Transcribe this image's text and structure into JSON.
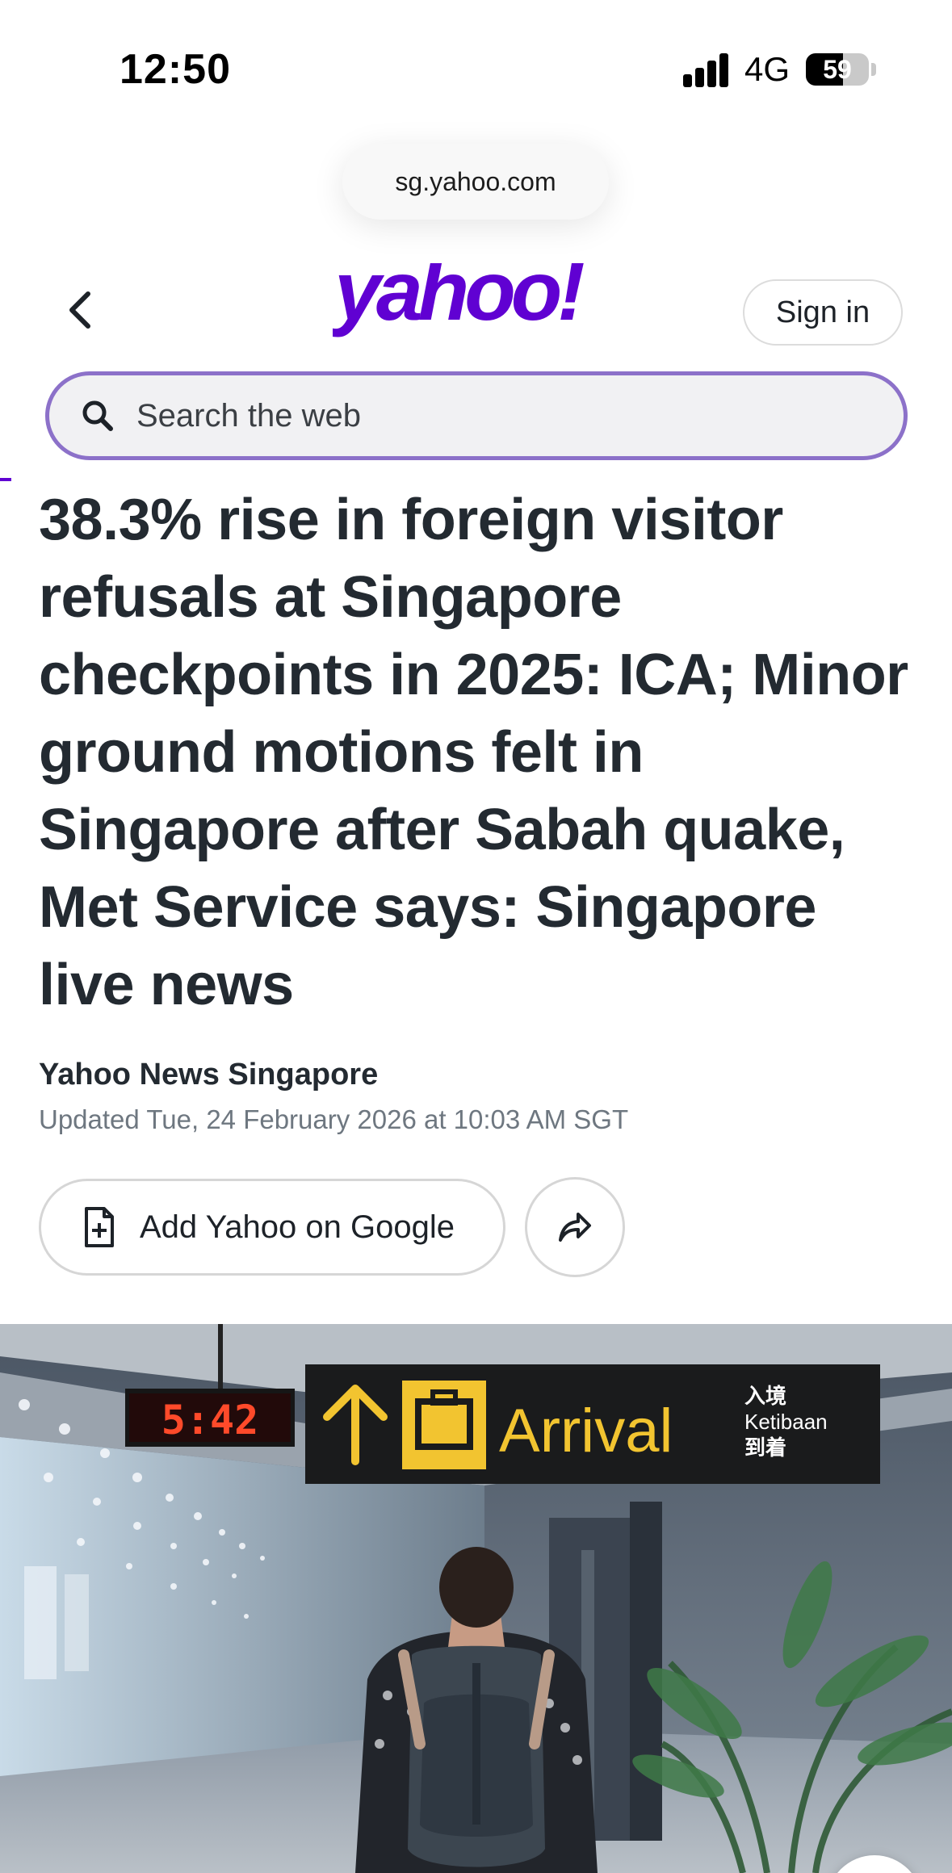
{
  "status_bar": {
    "time": "12:50",
    "network": "4G",
    "battery_percent": "59",
    "battery_level": 0.59
  },
  "browser": {
    "url": "sg.yahoo.com"
  },
  "header": {
    "logo_text": "yahoo!",
    "sign_in_label": "Sign in",
    "brand_color": "#6001d2"
  },
  "search": {
    "placeholder": "Search the web"
  },
  "article": {
    "headline": "38.3% rise in foreign visitor refusals at Singapore checkpoints in 2025: ICA; Minor ground motions felt in Singapore after Sabah quake, Met Service says: Singapore live news",
    "source": "Yahoo News Singapore",
    "updated": "Updated Tue, 24 February 2026 at 10:03 AM SGT",
    "add_button_label": "Add Yahoo on Google"
  },
  "hero_image": {
    "clock_text": "5:42",
    "sign_text": "Arrival",
    "sign_chinese_top": "入境",
    "sign_malay": "Ketibaan",
    "sign_chinese_bottom": "到着"
  },
  "icons": [
    "back-chevron-icon",
    "search-icon",
    "document-add-icon",
    "share-icon",
    "expand-icon",
    "signal-icon",
    "battery-icon"
  ]
}
